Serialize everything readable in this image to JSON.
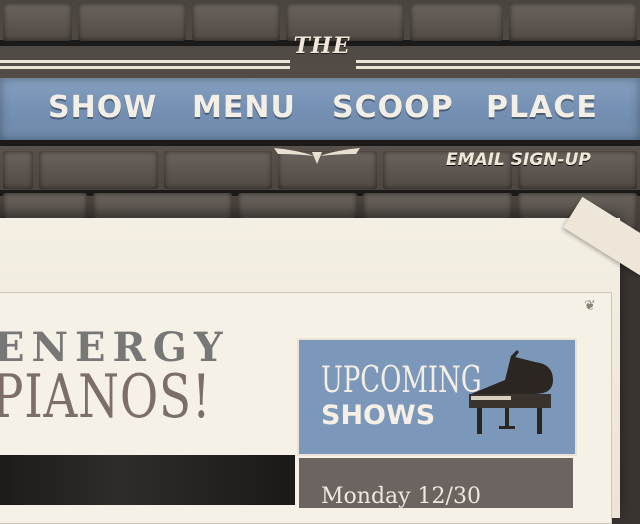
{
  "header": {
    "badge": "THE",
    "email_signup": "EMAIL SIGN-UP"
  },
  "nav": {
    "items": [
      "SHOW",
      "MENU",
      "SCOOP",
      "PLACE"
    ]
  },
  "hero": {
    "line1": "ENERGY",
    "line2": "PIANOS!"
  },
  "upcoming": {
    "line1": "UPCOMING",
    "line2": "SHOWS",
    "next_date": "Monday 12/30"
  },
  "colors": {
    "nav_blue": "#7490b3",
    "paper": "#f4efe4",
    "brick": "#5a524c"
  }
}
